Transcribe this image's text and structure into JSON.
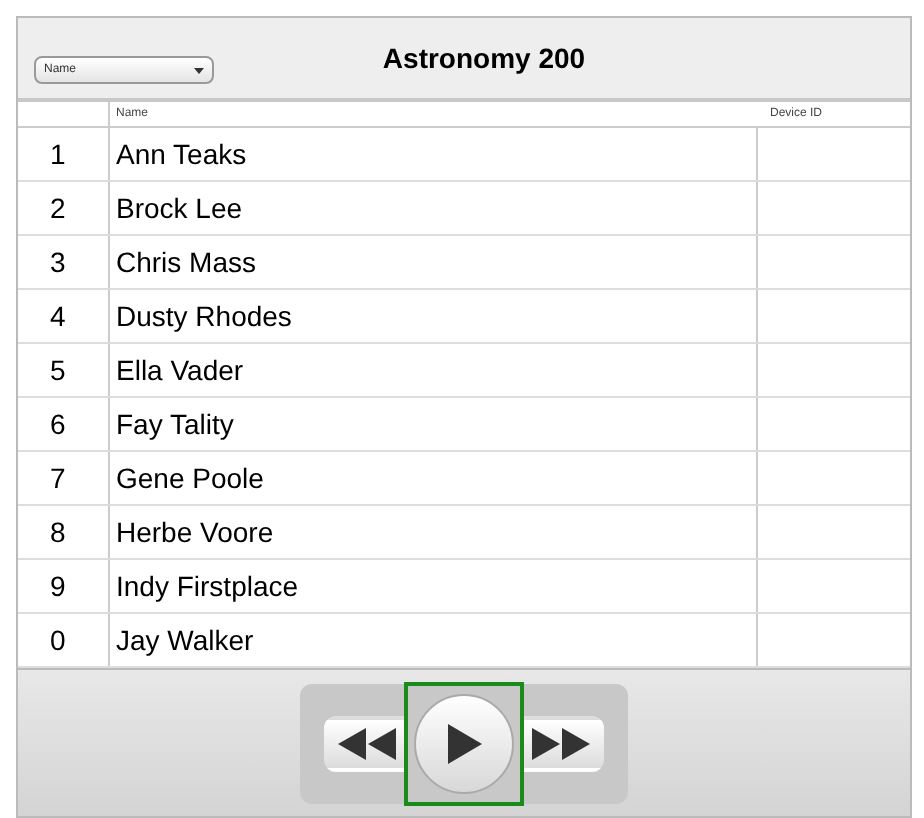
{
  "header": {
    "sort_select": {
      "value": "Name"
    },
    "title": "Astronomy 200"
  },
  "table": {
    "columns": [
      "Name",
      "Device ID"
    ],
    "rows": [
      {
        "number": "1",
        "name": "Ann Teaks"
      },
      {
        "number": "2",
        "name": "Brock Lee"
      },
      {
        "number": "3",
        "name": "Chris Mass"
      },
      {
        "number": "4",
        "name": "Dusty Rhodes"
      },
      {
        "number": "5",
        "name": "Ella Vader"
      },
      {
        "number": "6",
        "name": "Fay Tality"
      },
      {
        "number": "7",
        "name": "Gene Poole"
      },
      {
        "number": "8",
        "name": "Herbe Voore"
      },
      {
        "number": "9",
        "name": "Indy Firstplace"
      },
      {
        "number": "0",
        "name": "Jay Walker"
      }
    ]
  },
  "player": {
    "controls": [
      {
        "kind": "rewind",
        "selected": false
      },
      {
        "kind": "play",
        "selected": true
      },
      {
        "kind": "forward",
        "selected": false
      }
    ]
  }
}
